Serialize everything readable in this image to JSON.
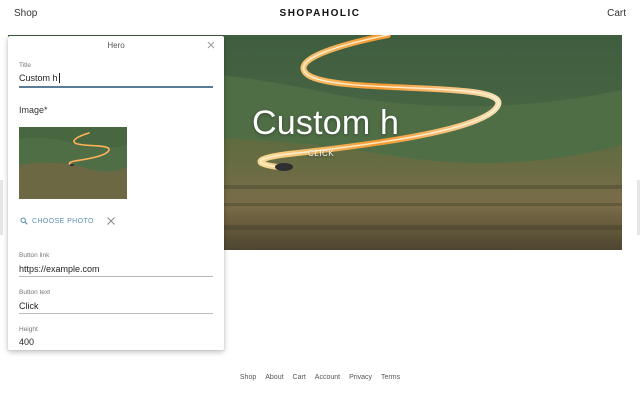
{
  "header": {
    "shop_link": "Shop",
    "brand": "SHOPAHOLIC",
    "cart_link": "Cart"
  },
  "hero": {
    "title": "Custom h",
    "button_text": "CLICK"
  },
  "editor_panel": {
    "title": "Hero",
    "fields": {
      "title": {
        "label": "Title",
        "value": "Custom h"
      },
      "image": {
        "label": "Image*",
        "choose_label": "CHOOSE PHOTO"
      },
      "button_link": {
        "label": "Button link",
        "value": "https://example.com"
      },
      "button_text": {
        "label": "Button text",
        "value": "Click"
      },
      "height": {
        "label": "Height",
        "value": "400"
      }
    }
  },
  "footer": {
    "links": [
      "Shop",
      "About",
      "Cart",
      "Account",
      "Privacy",
      "Terms"
    ]
  },
  "icons": {
    "close": "close-icon",
    "search": "search-icon",
    "remove": "close-icon"
  },
  "colors": {
    "accent": "#5b8fb0",
    "active_underline": "#5b7b97"
  }
}
